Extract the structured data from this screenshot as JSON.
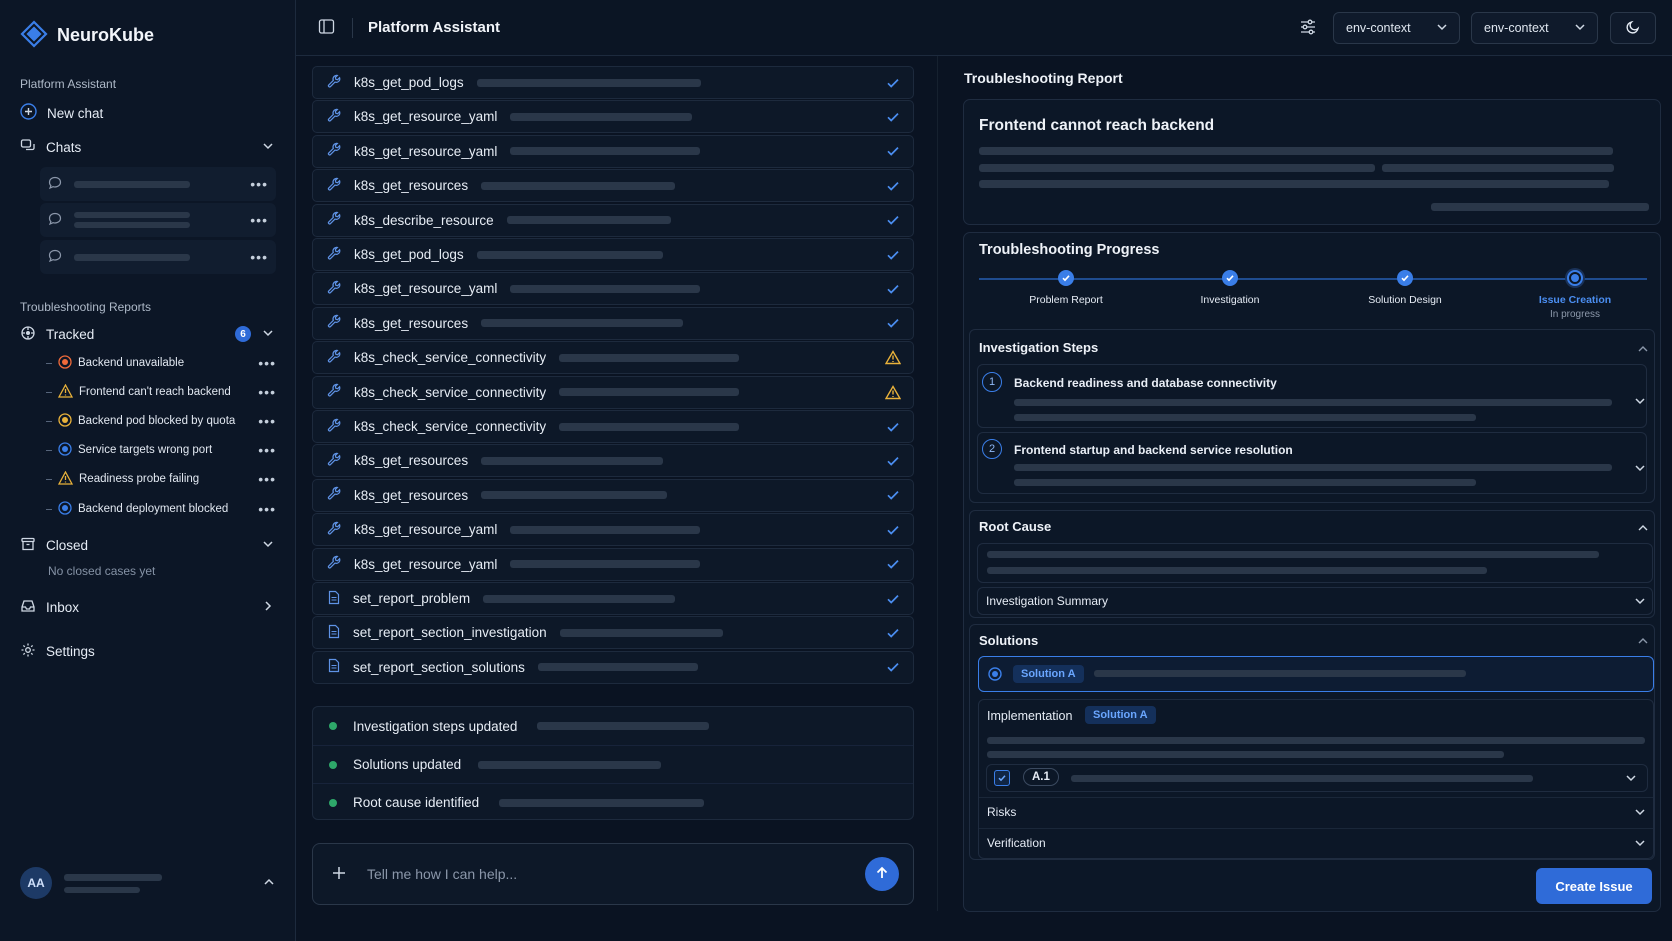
{
  "app": {
    "name": "NeuroKube"
  },
  "sidebar": {
    "section_label": "Platform Assistant",
    "new_chat": "New chat",
    "chats_label": "Chats",
    "reports_label": "Troubleshooting Reports",
    "tracked_label": "Tracked",
    "tracked_count": "6",
    "tracked": [
      {
        "label": "Backend unavailable",
        "status": "error"
      },
      {
        "label": "Frontend can't reach backend",
        "status": "warning"
      },
      {
        "label": "Backend pod blocked by quota",
        "status": "pending"
      },
      {
        "label": "Service targets wrong port",
        "status": "info"
      },
      {
        "label": "Readiness probe failing",
        "status": "warning"
      },
      {
        "label": "Backend deployment blocked",
        "status": "info"
      }
    ],
    "closed_label": "Closed",
    "closed_empty": "No closed cases yet",
    "inbox_label": "Inbox",
    "settings_label": "Settings",
    "user_initials": "AA"
  },
  "header": {
    "title": "Platform Assistant",
    "selects": [
      "env-context",
      "env-context"
    ]
  },
  "tools": [
    {
      "name": "k8s_get_pod_logs",
      "type": "tool",
      "status": "ok"
    },
    {
      "name": "k8s_get_resource_yaml",
      "type": "tool",
      "status": "ok"
    },
    {
      "name": "k8s_get_resource_yaml",
      "type": "tool",
      "status": "ok"
    },
    {
      "name": "k8s_get_resources",
      "type": "tool",
      "status": "ok"
    },
    {
      "name": "k8s_describe_resource",
      "type": "tool",
      "status": "ok"
    },
    {
      "name": "k8s_get_pod_logs",
      "type": "tool",
      "status": "ok"
    },
    {
      "name": "k8s_get_resource_yaml",
      "type": "tool",
      "status": "ok"
    },
    {
      "name": "k8s_get_resources",
      "type": "tool",
      "status": "ok"
    },
    {
      "name": "k8s_check_service_connectivity",
      "type": "tool",
      "status": "warning"
    },
    {
      "name": "k8s_check_service_connectivity",
      "type": "tool",
      "status": "warning"
    },
    {
      "name": "k8s_check_service_connectivity",
      "type": "tool",
      "status": "ok"
    },
    {
      "name": "k8s_get_resources",
      "type": "tool",
      "status": "ok"
    },
    {
      "name": "k8s_get_resources",
      "type": "tool",
      "status": "ok"
    },
    {
      "name": "k8s_get_resource_yaml",
      "type": "tool",
      "status": "ok"
    },
    {
      "name": "k8s_get_resource_yaml",
      "type": "tool",
      "status": "ok"
    },
    {
      "name": "set_report_problem",
      "type": "doc",
      "status": "ok"
    },
    {
      "name": "set_report_section_investigation",
      "type": "doc",
      "status": "ok"
    },
    {
      "name": "set_report_section_solutions",
      "type": "doc",
      "status": "ok"
    }
  ],
  "updates": [
    "Investigation steps updated",
    "Solutions updated",
    "Root cause identified"
  ],
  "composer": {
    "placeholder": "Tell me how I can help..."
  },
  "report": {
    "label": "Troubleshooting Report",
    "problem_title": "Frontend cannot reach backend",
    "progress_title": "Troubleshooting Progress",
    "steps": [
      {
        "label": "Problem Report",
        "state": "done"
      },
      {
        "label": "Investigation",
        "state": "done"
      },
      {
        "label": "Solution Design",
        "state": "done"
      },
      {
        "label": "Issue Creation",
        "state": "active",
        "sub": "In progress"
      }
    ],
    "investigation_title": "Investigation Steps",
    "investigation_steps": [
      {
        "num": "1",
        "title": "Backend readiness and database connectivity"
      },
      {
        "num": "2",
        "title": "Frontend startup and backend service resolution"
      }
    ],
    "root_cause_title": "Root Cause",
    "investigation_summary": "Investigation Summary",
    "solutions_title": "Solutions",
    "solution_pill": "Solution A",
    "implementation_label": "Implementation",
    "implementation_pill": "Solution A",
    "task_tag": "A.1",
    "risks_label": "Risks",
    "verification_label": "Verification",
    "create_issue": "Create Issue"
  },
  "colors": {
    "accent": "#2f6bd8",
    "success": "#2ea86a",
    "warning": "#e9b23b",
    "error": "#f06a3a"
  }
}
